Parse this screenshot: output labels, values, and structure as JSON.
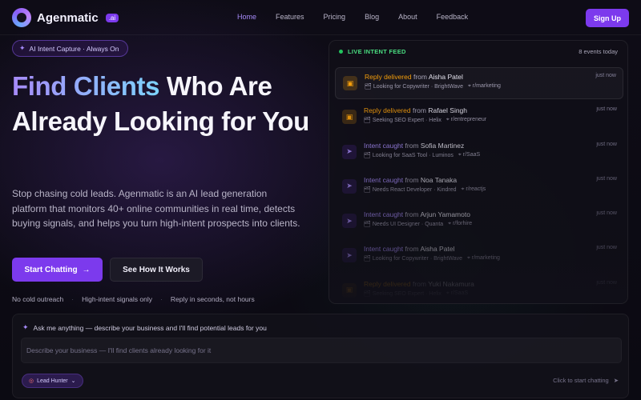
{
  "brand": {
    "name": "Agenmatic",
    "badge": ".ai"
  },
  "nav": {
    "links": [
      {
        "label": "Home",
        "active": true
      },
      {
        "label": "Features"
      },
      {
        "label": "Pricing"
      },
      {
        "label": "Blog"
      },
      {
        "label": "About"
      },
      {
        "label": "Feedback"
      }
    ],
    "signup_label": "Sign Up"
  },
  "hero": {
    "pill": "AI Intent Capture · Always On",
    "headline_highlight": "Find Clients",
    "headline_rest": " Who Are Already Looking for You",
    "description": "Stop chasing cold leads. Agenmatic is an AI lead generation platform that monitors 40+ online communities in real time, detects buying signals, and helps you turn high-intent prospects into clients.",
    "primary_cta": "Start Chatting",
    "secondary_cta": "See How It Works",
    "bullets": [
      "No cold outreach",
      "High-intent signals only",
      "Reply in seconds, not hours"
    ]
  },
  "feed": {
    "title": "LIVE INTENT FEED",
    "count": "8 events today",
    "from_word": "from",
    "items": [
      {
        "kind": "reply",
        "status": "Reply delivered",
        "name": "Aisha Patel",
        "need": "Looking for Copywriter · BrightWave",
        "community": "r/marketing",
        "time": "just now"
      },
      {
        "kind": "reply",
        "status": "Reply delivered",
        "name": "Rafael Singh",
        "need": "Seeking SEO Expert · Helix",
        "community": "r/entrepreneur",
        "time": "just now"
      },
      {
        "kind": "intent",
        "status": "Intent caught",
        "name": "Sofia Martinez",
        "need": "Looking for SaaS Tool · Luminos",
        "community": "r/SaaS",
        "time": "just now"
      },
      {
        "kind": "intent",
        "status": "Intent caught",
        "name": "Noa Tanaka",
        "need": "Needs React Developer · Kindred",
        "community": "r/reactjs",
        "time": "just now"
      },
      {
        "kind": "intent",
        "status": "Intent caught",
        "name": "Arjun Yamamoto",
        "need": "Needs UI Designer · Quanta",
        "community": "r/forhire",
        "time": "just now"
      },
      {
        "kind": "intent",
        "status": "Intent caught",
        "name": "Aisha Patel",
        "need": "Looking for Copywriter · BrightWave",
        "community": "r/marketing",
        "time": "just now"
      },
      {
        "kind": "reply",
        "status": "Reply delivered",
        "name": "Yuki Nakamura",
        "need": "Seeking SEO Expert · Helix",
        "community": "r/SaaS",
        "time": "just now"
      }
    ]
  },
  "chat": {
    "prompt": "Ask me anything — describe your business and I'll find potential leads for you",
    "placeholder": "Describe your business — I'll find clients already looking for it",
    "agent": "Lead Hunter",
    "hint": "Click to start chatting"
  },
  "colors": {
    "accent": "#7c3aed",
    "reply": "#f59e0b",
    "intent": "#a78bfa",
    "live": "#22c55e"
  }
}
